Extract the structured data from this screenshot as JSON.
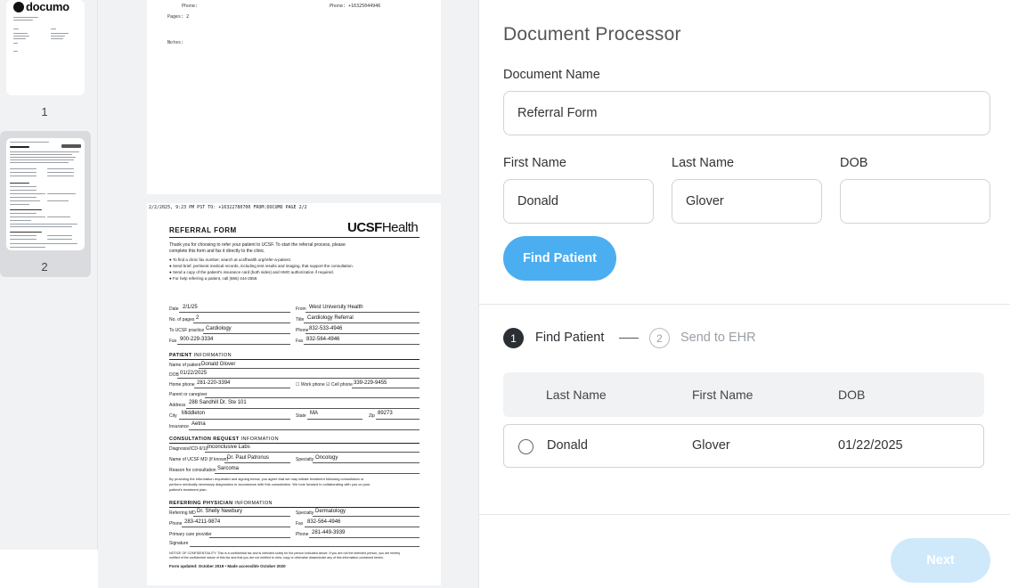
{
  "thumbnails": {
    "items": [
      {
        "number": "1",
        "logo": "documo"
      },
      {
        "number": "2",
        "selected": true
      }
    ]
  },
  "document": {
    "page1": {
      "phone_left": "Phone:",
      "phone_right": "Phone: +16325044946",
      "pages": "Pages: 2",
      "notes": "Notes:"
    },
    "page2": {
      "fax_header": "2/2/2025, 9:23 PM PST TO: +16322780700 FROM:DOCUMO PAGE 2/2",
      "title": "REFERRAL FORM",
      "brand_a": "UCSF",
      "brand_b": "Health",
      "intro1": "Thank you for choosing to refer your patient to UCSF. To start the referral process, please",
      "intro2": "complete this form and fax it directly to the clinic.",
      "bullet1": "● To find a clinic fax number, search at ucsfhealth.org/refer-a-patient.",
      "bullet2": "● Send brief, pertinent medical records, including test results and imaging, that support the consultation.",
      "bullet3": "● Send a copy of the patient's insurance card (both sides) and HMO authorization if required.",
      "bullet4": "● For help referring a patient, call (866) 444-2559.",
      "date_label": "Date",
      "date_value": "2/1/25",
      "from_label": "From",
      "from_value": "West University Health",
      "pages_label": "No. of pages",
      "pages_value": "2",
      "title_label": "Title",
      "title_value": "Cardiology Referral",
      "to_label": "To UCSF practice",
      "to_value": "Cardiology",
      "phone_label": "Phone",
      "phone_value": "832-533-4946",
      "fax_label": "Fax",
      "fax_value": "900-229-3334",
      "fax2_label": "Fax",
      "fax2_value": "832-564-4946",
      "patient_section_a": "PATIENT",
      "patient_section_b": "INFORMATION",
      "name_label": "Name of patient",
      "name_value": "Donald Glover",
      "dob_label": "DOB",
      "dob_value": "01/22/2025",
      "home_label": "Home phone",
      "home_value": "281-220-3394",
      "work_label": "Work phone",
      "cell_label": "Cell phone",
      "cell_value": "339-229-9455",
      "caregiver_label": "Parent or caregiver",
      "address_label": "Address",
      "address_value": "288 Sandhill Dr. Ste 101",
      "city_label": "City",
      "city_value": "Middleton",
      "state_label": "State",
      "state_value": "MA",
      "zip_label": "Zip",
      "zip_value": "89273",
      "insurance_label": "Insurance",
      "insurance_value": "Aetna",
      "consult_section_a": "CONSULTATION REQUEST",
      "consult_section_b": "INFORMATION",
      "diag_label": "Diagnosis/ICD-9/10",
      "diag_value": "Inconclusive Labs",
      "md_label": "Name of UCSF MD (if known)",
      "md_value": "Dr. Paul Patronus",
      "specialty_label": "Specialty",
      "specialty_value": "Oncology",
      "reason_label": "Reason for consultation",
      "reason_value": "Sarcoma",
      "consent1": "By providing the information requested and signing below, you agree that we may initiate treatment following consultation or",
      "consent2": "perform medically necessary diagnostics in accordance with this consultation. We look forward to collaborating with you on your",
      "consent3": "patient's treatment plan.",
      "referring_section_a": "REFERRING PHYSICIAN",
      "referring_section_b": "INFORMATION",
      "ref_md_label": "Referring MD",
      "ref_md_value": "Dr. Shelly Newbury",
      "ref_spec_label": "Specialty",
      "ref_spec_value": "Dermatology",
      "ref_phone_label": "Phone",
      "ref_phone_value": "283-4211-9874",
      "ref_fax_label": "Fax",
      "ref_fax_value": "832-564-4946",
      "pcp_label": "Primary care provider",
      "pcp_phone_label": "Phone",
      "pcp_phone_value": "281-449-3939",
      "signature_label": "Signature",
      "notice1": "NOTICE OF CONFIDENTIALITY: This is a confidential fax and is intended solely for the person indicated above. If you are not the intended person, you are hereby",
      "notice2": "notified of the confidential nature of this fax and that you are not entitled to view, copy or otherwise disseminate any of this information contained herein.",
      "footer": "Form updated: October 2019 • Made accessible October 2020"
    }
  },
  "processor": {
    "title": "Document Processor",
    "document_name_label": "Document Name",
    "document_name_value": "Referral Form",
    "first_name_label": "First Name",
    "first_name_value": "Donald",
    "last_name_label": "Last Name",
    "last_name_value": "Glover",
    "dob_label": "DOB",
    "dob_value": "",
    "find_button": "Find Patient",
    "steps": [
      {
        "number": "1",
        "label": "Find Patient",
        "active": true
      },
      {
        "number": "2",
        "label": "Send to EHR",
        "active": false
      }
    ],
    "table": {
      "columns": [
        "Last Name",
        "First Name",
        "DOB"
      ],
      "rows": [
        {
          "last_name": "Donald",
          "first_name": "Glover",
          "dob": "01/22/2025"
        }
      ]
    },
    "next_button": "Next"
  },
  "colors": {
    "primary": "#4aaef0",
    "primary_disabled": "#cfe9fb",
    "step_active": "#2b2f33",
    "panel_background": "#f1f2f4"
  }
}
